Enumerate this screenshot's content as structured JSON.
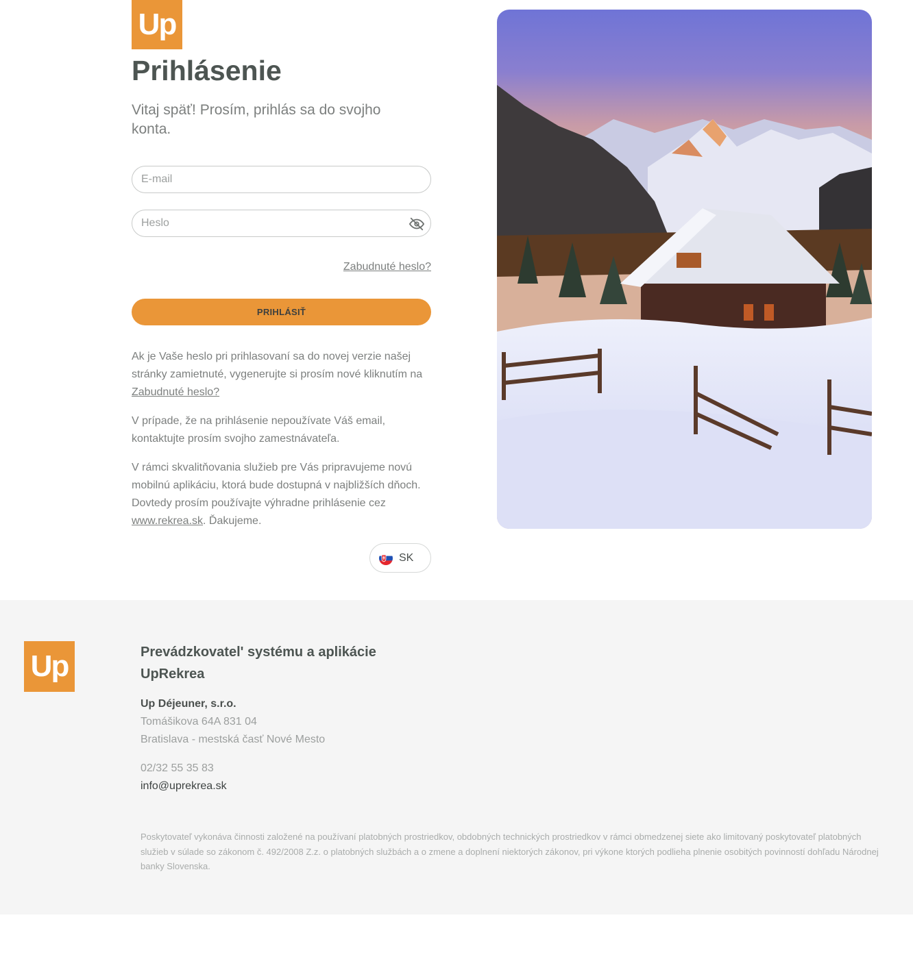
{
  "brand": {
    "logo_text": "Up",
    "accent_color": "#ea9638"
  },
  "login": {
    "title": "Prihlásenie",
    "subtitle": "Vitaj späť! Prosím, prihlás sa do svojho konta.",
    "email_placeholder": "E-mail",
    "password_placeholder": "Heslo",
    "password_toggle_icon": "eye-off-icon",
    "forgot_link": "Zabudnuté heslo?",
    "submit_label": "PRIHLÁSIŤ"
  },
  "info": {
    "p1_text": "Ak je Vaše heslo pri prihlasovaní sa do novej verzie našej stránky zamietnuté, vygenerujte si prosím nové kliknutím na ",
    "p1_link": "Zabudnuté heslo?",
    "p2_text": "V prípade, že na prihlásenie nepoužívate Váš email, kontaktujte prosím svojho zamestnávateľa.",
    "p3_text": "V rámci skvalitňovania služieb pre Vás pripravujeme novú mobilnú aplikáciu, ktorá bude dostupná v najbližších dňoch. Dovtedy prosím používajte výhradne prihlásenie cez ",
    "p3_link": "www.rekrea.sk",
    "p3_suffix": ". Ďakujeme."
  },
  "language": {
    "code": "SK",
    "flag_icon": "slovak-flag-icon"
  },
  "footer": {
    "heading": "Prevádzkovatel' systému a aplikácie UpRekrea",
    "company": "Up Déjeuner, s.r.o.",
    "address_line1": "Tomášikova 64A 831 04",
    "address_line2": "Bratislava - mestská časť Nové Mesto",
    "phone": "02/32 55 35 83",
    "email": "info@uprekrea.sk",
    "legal": "Poskytovateľ vykonáva činnosti založené na používaní platobných prostriedkov, obdobných technických prostriedkov v rámci obmedzenej siete ako limitovaný poskytovateľ platobných služieb v súlade so zákonom č. 492/2008 Z.z. o platobných službách a o zmene a doplnení niektorých zákonov, pri výkone ktorých podlieha plnenie osobitých povinností dohľadu Národnej banky Slovenska."
  }
}
